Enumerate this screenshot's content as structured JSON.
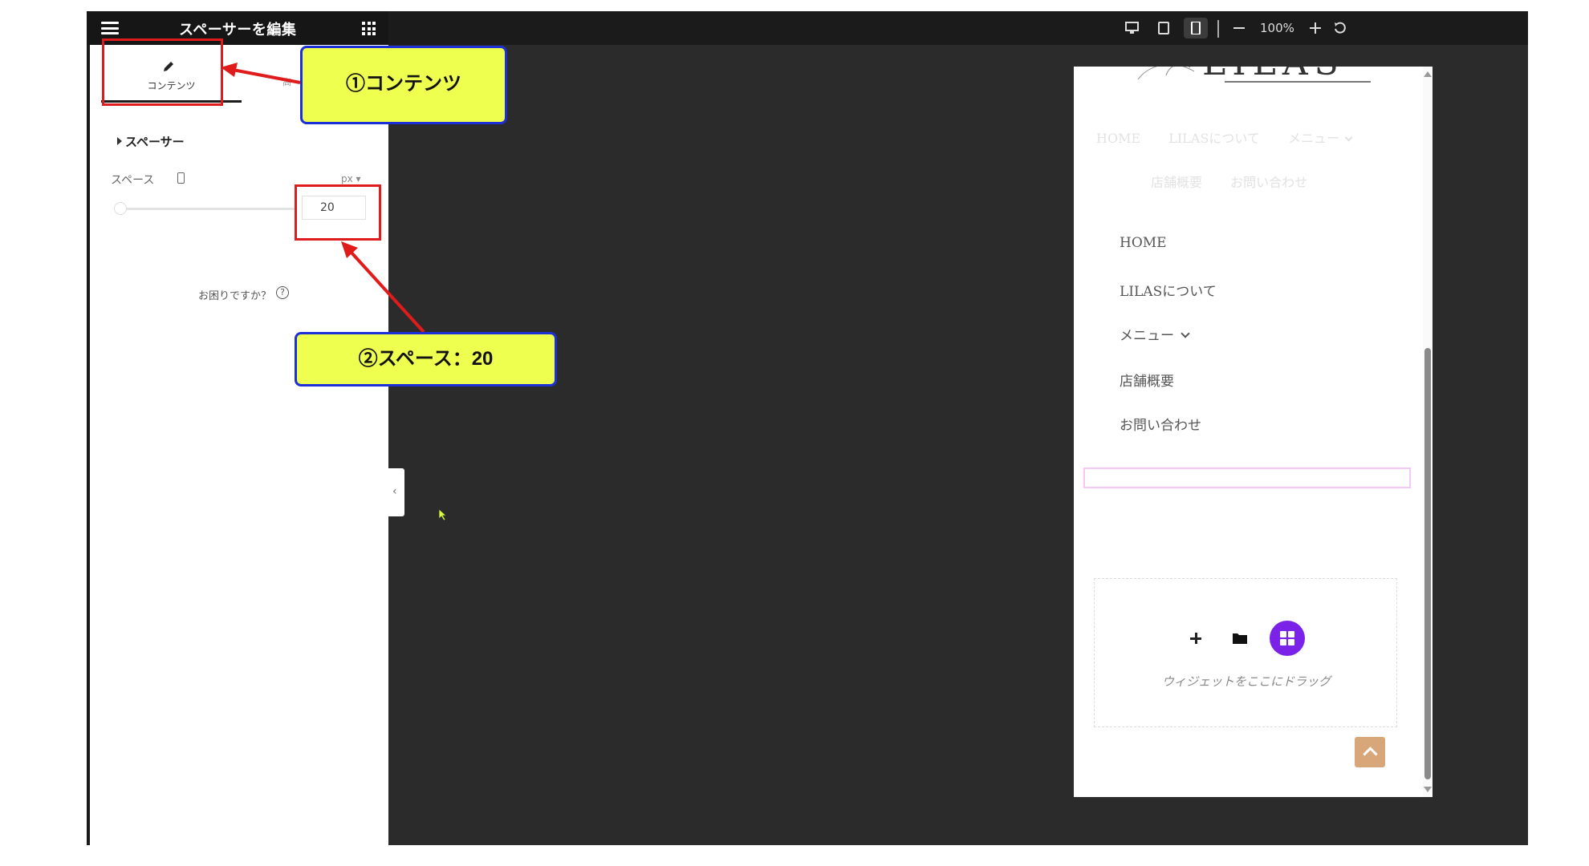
{
  "header": {
    "title": "スペーサーを編集",
    "zoom": "100%"
  },
  "panel": {
    "tab_content": "コンテンツ",
    "tab_style": "高",
    "section_title": "スペーサー",
    "space_label": "スペース",
    "unit": "px",
    "space_value": "20",
    "help": "お困りですか？",
    "help_icon": "?"
  },
  "preview": {
    "logo": "LILAS",
    "faded_nav_row1": [
      "HOME",
      "LILASについて",
      "メニュー"
    ],
    "faded_nav_row2": [
      "店舗概要",
      "お問い合わせ"
    ],
    "menu": [
      "HOME",
      "LILASについて",
      "メニュー",
      "店舗概要",
      "お問い合わせ"
    ],
    "drop_label": "ウィジェットをここにドラッグ"
  },
  "annotations": {
    "callout1": "①コンテンツ",
    "callout2": "②スペース：20",
    "box_color": "#e01b1b",
    "callout_bg": "#efff4f",
    "callout_border": "#1c2fd8"
  },
  "colors": {
    "canvas": "#2b2b2b",
    "topbar": "#1b1b1b",
    "widget_button": "#7b22e8",
    "scroll_top_button": "#d7a77a"
  }
}
